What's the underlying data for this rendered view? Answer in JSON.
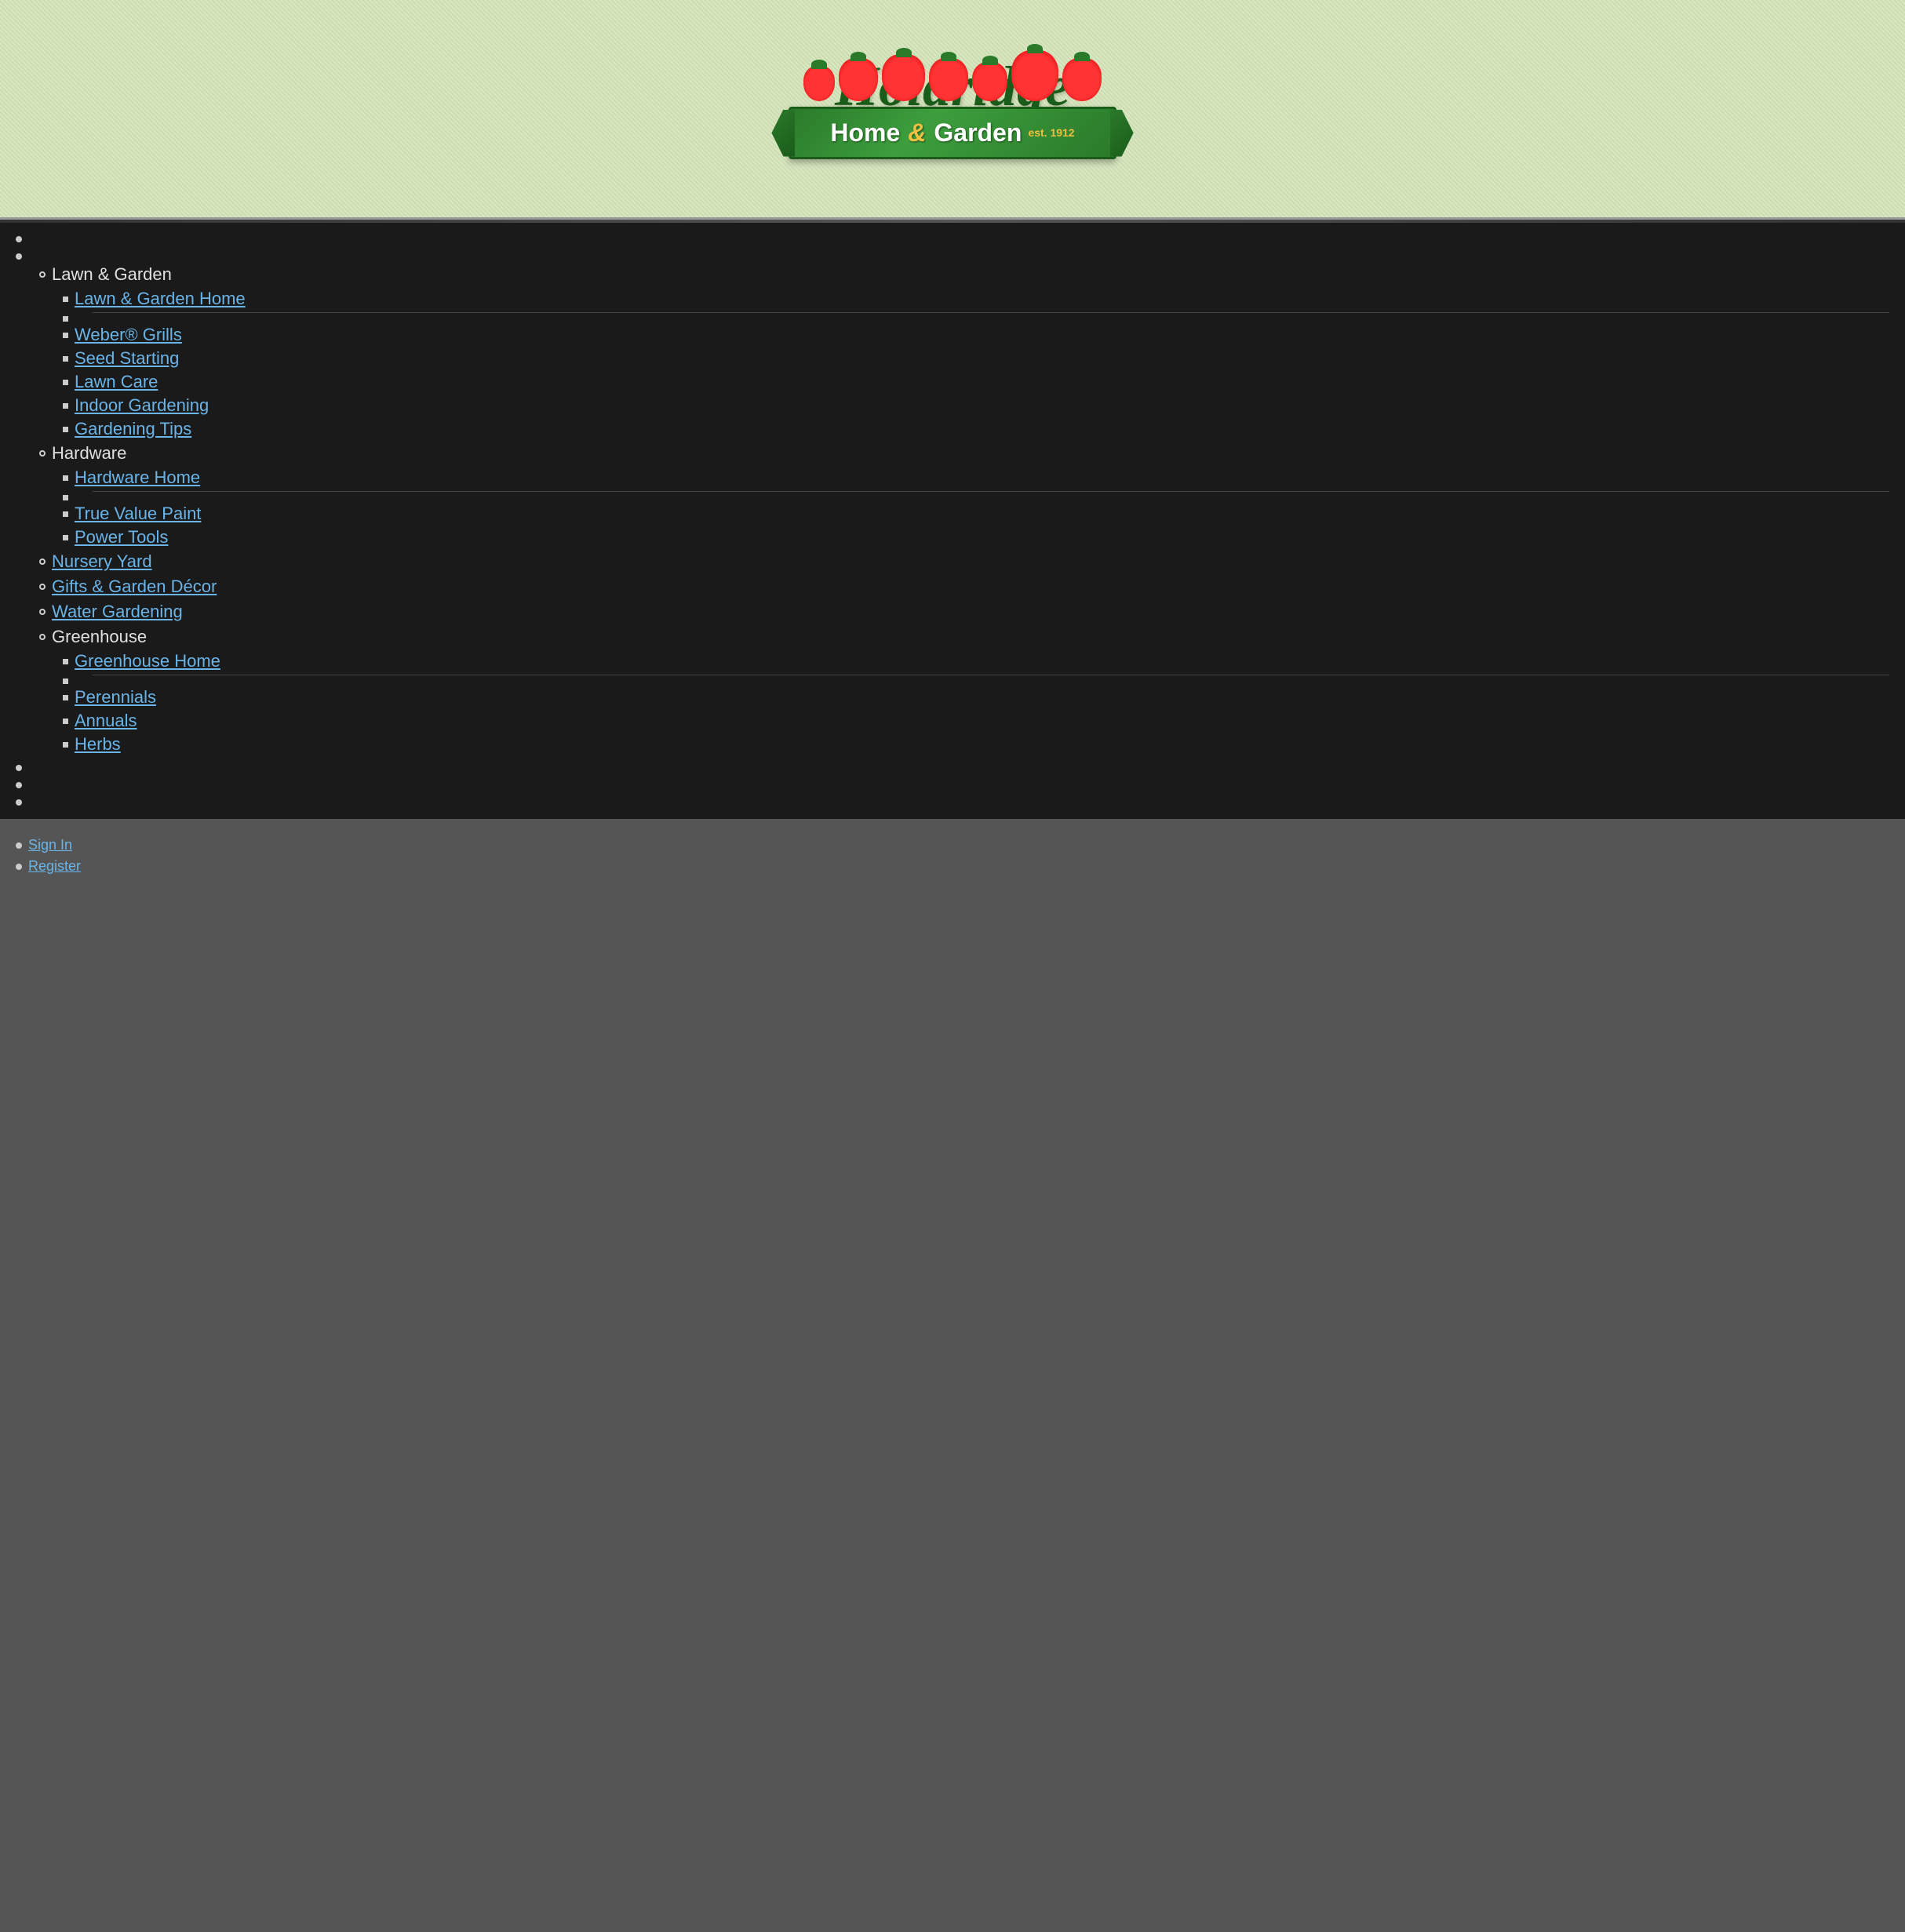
{
  "header": {
    "title": "Holdridge",
    "subtitle_part1": "Home",
    "subtitle_ampersand": "&",
    "subtitle_part2": "Garden",
    "est": "est. 1912"
  },
  "nav": {
    "lawn_garden_label": "Lawn & Garden",
    "lawn_garden_home": "Lawn & Garden Home",
    "weber_grills": "Weber® Grills",
    "seed_starting": "Seed Starting",
    "lawn_care": "Lawn Care",
    "indoor_gardening": "Indoor Gardening",
    "gardening_tips": "Gardening Tips",
    "hardware_label": "Hardware",
    "hardware_home": "Hardware Home",
    "true_value_paint": "True Value Paint",
    "power_tools": "Power Tools",
    "nursery_yard": "Nursery Yard",
    "gifts_garden_decor": "Gifts & Garden Décor",
    "water_gardening": "Water Gardening",
    "greenhouse_label": "Greenhouse",
    "greenhouse_home": "Greenhouse Home",
    "perennials": "Perennials",
    "annuals": "Annuals",
    "herbs": "Herbs"
  },
  "bottom": {
    "sign_in": "Sign In",
    "register": "Register"
  }
}
